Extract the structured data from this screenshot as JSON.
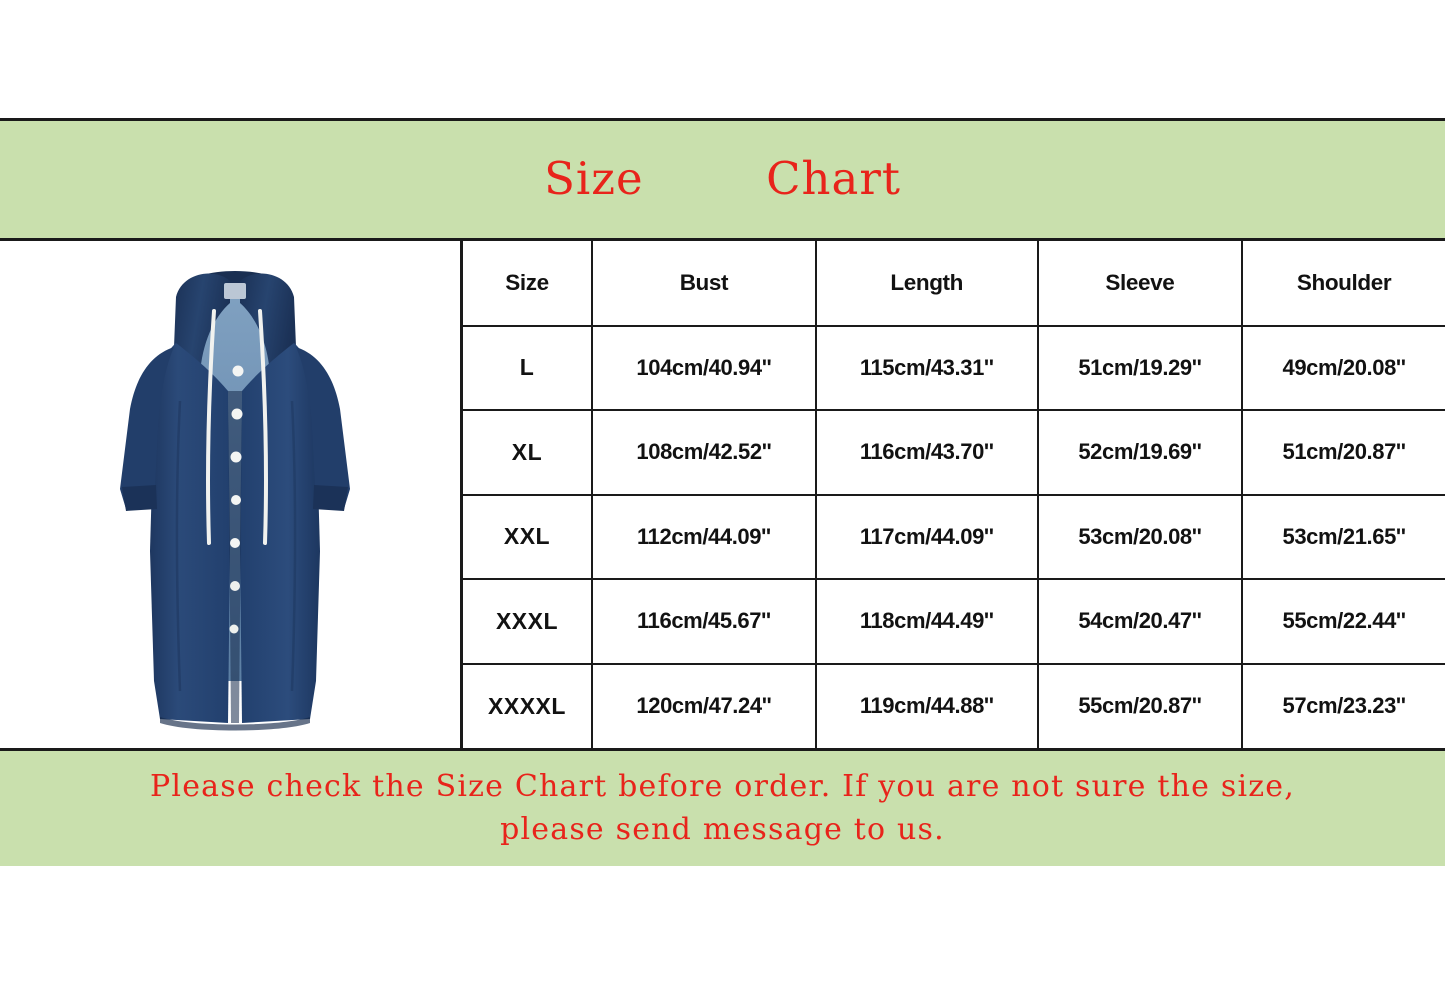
{
  "card": {
    "title": "Size        Chart",
    "title_color": "#e8241b",
    "band_color": "#c9e0ad",
    "border_color": "#1a1a1a"
  },
  "product": {
    "image_name": "denim-hooded-long-coat",
    "alt": "Navy blue denim hooded long coat with white drawstrings and front buttons",
    "colors": {
      "denim_dark": "#24406b",
      "denim_mid": "#2d4d7e",
      "denim_light": "#577ca8",
      "lining": "#6d93b8",
      "drawstring": "#f2f2f0",
      "button": "#f4f5f3"
    }
  },
  "table": {
    "columns": [
      "Size",
      "Bust",
      "Length",
      "Sleeve",
      "Shoulder"
    ],
    "rows": [
      {
        "size": "L",
        "bust": "104cm/40.94''",
        "length": "115cm/43.31''",
        "sleeve": "51cm/19.29''",
        "shoulder": "49cm/20.08''"
      },
      {
        "size": "XL",
        "bust": "108cm/42.52''",
        "length": "116cm/43.70''",
        "sleeve": "52cm/19.69''",
        "shoulder": "51cm/20.87''"
      },
      {
        "size": "XXL",
        "bust": "112cm/44.09''",
        "length": "117cm/44.09''",
        "sleeve": "53cm/20.08''",
        "shoulder": "53cm/21.65''"
      },
      {
        "size": "XXXL",
        "bust": "116cm/45.67''",
        "length": "118cm/44.49''",
        "sleeve": "54cm/20.47''",
        "shoulder": "55cm/22.44''"
      },
      {
        "size": "XXXXL",
        "bust": "120cm/47.24''",
        "length": "119cm/44.88''",
        "sleeve": "55cm/20.87''",
        "shoulder": "57cm/23.23''"
      }
    ]
  },
  "footer": {
    "line1": "Please check the Size Chart before order. If you are not sure the size,",
    "line2": "please send message to us."
  }
}
